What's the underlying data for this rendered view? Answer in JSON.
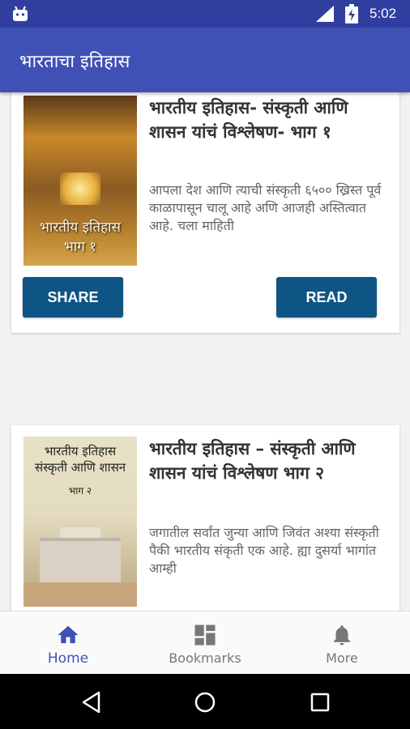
{
  "status_bar": {
    "time": "5:02",
    "icons": [
      "android-icon",
      "signal-icon",
      "battery-icon"
    ]
  },
  "app_bar": {
    "title": "भारताचा इतिहास"
  },
  "cards": [
    {
      "title": "भारतीय इतिहास- संस्कृती आणि शासन यांचं विश्लेषण- भाग १",
      "description": "आपला देश आणि त्याची संस्कृती ६५०० ख्रिस्त पूर्व काळापासून चालू आहे अणि आजही अस्तित्वात आहे. चला माहिती",
      "cover_text_line1": "भारतीय इतिहास",
      "cover_text_line2": "भाग १",
      "share_label": "SHARE",
      "read_label": "READ"
    },
    {
      "title": "भारतीय इतिहास – संस्कृती आणि शासन यांचं विश्लेषण भाग २",
      "description": "जगातील सर्वांत जुन्या आणि जिवंत अश्या संस्कृती पैकी भारतीय संकृती एक आहे. ह्या दुसर्या भागांत आम्ही",
      "cover_text_line1": "भारतीय इतिहास",
      "cover_text_line2": "संस्कृती आणि शासन",
      "cover_text_line3": "भाग २"
    }
  ],
  "bottom_nav": {
    "items": [
      {
        "label": "Home",
        "icon": "home-icon",
        "active": true
      },
      {
        "label": "Bookmarks",
        "icon": "bookmarks-icon",
        "active": false
      },
      {
        "label": "More",
        "icon": "bell-icon",
        "active": false
      }
    ]
  },
  "colors": {
    "status_bar": "#303f9f",
    "app_bar": "#3f51b5",
    "button": "#0e5585",
    "active_nav": "#3f51b5"
  }
}
